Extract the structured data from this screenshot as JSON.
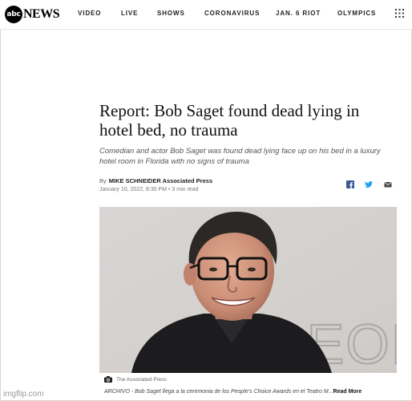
{
  "brand": {
    "logo_mark": "abc",
    "logo_text": "NEWS"
  },
  "nav": {
    "items": [
      {
        "label": "VIDEO"
      },
      {
        "label": "LIVE"
      },
      {
        "label": "SHOWS"
      },
      {
        "label": "CORONAVIRUS"
      },
      {
        "label": "JAN. 6 RIOT"
      },
      {
        "label": "OLYMPICS"
      }
    ],
    "menu_icon": "grid-menu-icon"
  },
  "article": {
    "headline": "Report: Bob Saget found dead lying in hotel bed, no trauma",
    "dek": "Comedian and actor Bob Saget was found dead lying face up on his bed in a luxury hotel room in Florida with no signs of trauma",
    "byline_prefix": "By",
    "author": "MIKE SCHNEIDER Associated Press",
    "dateline": "January 10, 2022, 8:30 PM • 3 min read",
    "share_icons": [
      "facebook-icon",
      "twitter-icon",
      "email-icon"
    ]
  },
  "photo": {
    "backdrop_text": "PEOPLE",
    "credit": "The Associated Press",
    "caption": "ARCHIVO - Bob Saget llega a la ceremonia de los People's Choice Awards en el Teatro M...",
    "read_more": "Read More"
  },
  "watermark": "imgflip.com",
  "colors": {
    "facebook": "#3b5998",
    "twitter": "#1da1f2",
    "text": "#111111",
    "muted": "#555555"
  }
}
